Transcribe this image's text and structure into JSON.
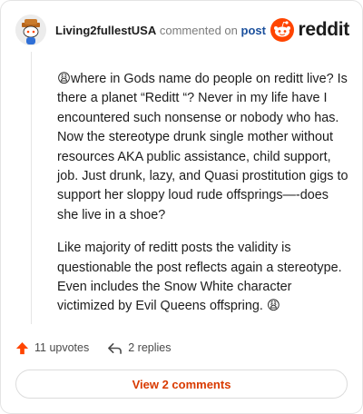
{
  "comment": {
    "username": "Living2fullestUSA",
    "action_text": "commented on",
    "post_link_label": "post",
    "paragraphs": [
      "😩where in Gods name do people on reditt live? Is there a planet “Reditt “? Never in my life have I encountered such nonsense or nobody who has. Now the stereotype drunk single mother without resources AKA public assistance, child support, job. Just drunk, lazy, and Quasi prostitution gigs to support her sloppy loud rude offsprings—-does she live in a shoe?",
      "Like majority of reditt posts the validity is questionable the post reflects again a stereotype. Even includes the Snow White character victimized by Evil Queens offspring. 😩"
    ]
  },
  "brand": {
    "wordmark": "reddit",
    "icon": "reddit-snoo-icon",
    "color": "#ff4500"
  },
  "footer": {
    "upvotes_label": "11 upvotes",
    "upvote_icon": "upvote-arrow-icon",
    "upvote_color": "#ff4500",
    "replies_label": "2 replies",
    "reply_icon": "reply-arrow-icon"
  },
  "view_comments_label": "View 2 comments",
  "colors": {
    "accent": "#d93a00",
    "link": "#1a4f9c"
  }
}
